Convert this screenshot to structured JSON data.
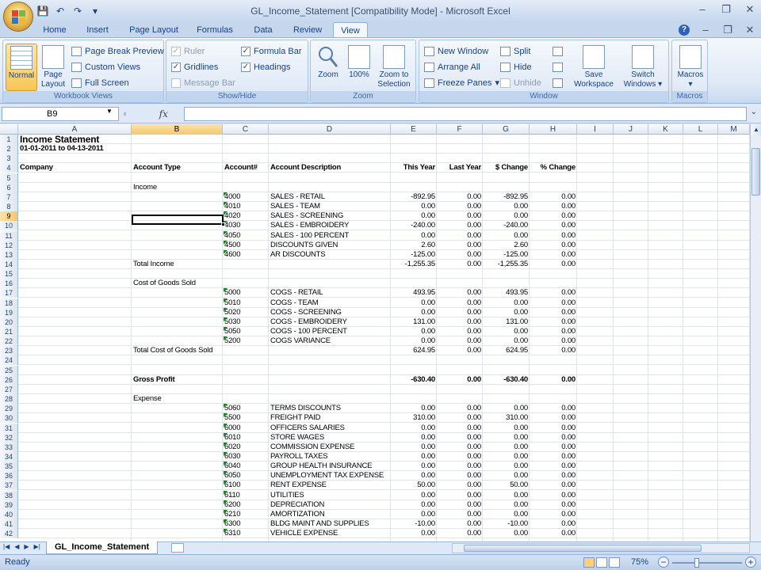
{
  "window": {
    "title": "GL_Income_Statement [Compatibility Mode] - Microsoft Excel",
    "minimize": "–",
    "restore": "❐",
    "close": "✕"
  },
  "qat": {
    "save": "💾",
    "undo": "↶",
    "redo": "↷",
    "customize": "▾"
  },
  "tabs": [
    "Home",
    "Insert",
    "Page Layout",
    "Formulas",
    "Data",
    "Review",
    "View"
  ],
  "active_tab": "View",
  "ribbon": {
    "workbook_views": {
      "label": "Workbook Views",
      "normal": "Normal",
      "page_layout_1": "Page",
      "page_layout_2": "Layout",
      "page_break_preview": "Page Break Preview",
      "custom_views": "Custom Views",
      "full_screen": "Full Screen"
    },
    "show_hide": {
      "label": "Show/Hide",
      "ruler": "Ruler",
      "gridlines": "Gridlines",
      "message_bar": "Message Bar",
      "formula_bar": "Formula Bar",
      "headings": "Headings"
    },
    "zoom": {
      "label": "Zoom",
      "zoom": "Zoom",
      "hundred": "100%",
      "zoom_selection_1": "Zoom to",
      "zoom_selection_2": "Selection"
    },
    "window": {
      "label": "Window",
      "new_window": "New Window",
      "arrange_all": "Arrange All",
      "freeze_panes": "Freeze Panes",
      "split": "Split",
      "hide": "Hide",
      "unhide": "Unhide",
      "save_workspace_1": "Save",
      "save_workspace_2": "Workspace",
      "switch_windows_1": "Switch",
      "switch_windows_2": "Windows"
    },
    "macros": {
      "label": "Macros",
      "macros": "Macros"
    }
  },
  "formula_bar": {
    "name_box": "B9",
    "fx": "fx",
    "formula": ""
  },
  "columns": [
    "A",
    "B",
    "C",
    "D",
    "E",
    "F",
    "G",
    "H",
    "I",
    "J",
    "K",
    "L",
    "M"
  ],
  "selected_column": "B",
  "selected_row": 9,
  "sheet": {
    "title": "Income Statement",
    "date_range": "01-01-2011 to 04-13-2011",
    "headers": {
      "company": "Company",
      "account_type": "Account Type",
      "account_num": "Account#",
      "account_desc": "Account Description",
      "this_year": "This Year",
      "last_year": "Last Year",
      "dollar_change": "$ Change",
      "pct_change": "% Change"
    },
    "rows": [
      {
        "r": 6,
        "b": "Income"
      },
      {
        "r": 7,
        "c": "4000",
        "d": "SALES - RETAIL",
        "e": "-892.95",
        "f": "0.00",
        "g": "-892.95",
        "h": "0.00"
      },
      {
        "r": 8,
        "c": "4010",
        "d": "SALES - TEAM",
        "e": "0.00",
        "f": "0.00",
        "g": "0.00",
        "h": "0.00"
      },
      {
        "r": 9,
        "c": "4020",
        "d": "SALES - SCREENING",
        "e": "0.00",
        "f": "0.00",
        "g": "0.00",
        "h": "0.00"
      },
      {
        "r": 10,
        "c": "4030",
        "d": "SALES - EMBROIDERY",
        "e": "-240.00",
        "f": "0.00",
        "g": "-240.00",
        "h": "0.00"
      },
      {
        "r": 11,
        "c": "4050",
        "d": "SALES - 100 PERCENT",
        "e": "0.00",
        "f": "0.00",
        "g": "0.00",
        "h": "0.00"
      },
      {
        "r": 12,
        "c": "4500",
        "d": "DISCOUNTS GIVEN",
        "e": "2.60",
        "f": "0.00",
        "g": "2.60",
        "h": "0.00"
      },
      {
        "r": 13,
        "c": "4600",
        "d": "AR DISCOUNTS",
        "e": "-125.00",
        "f": "0.00",
        "g": "-125.00",
        "h": "0.00"
      },
      {
        "r": 14,
        "b": "Total Income",
        "e": "-1,255.35",
        "f": "0.00",
        "g": "-1,255.35",
        "h": "0.00"
      },
      {
        "r": 16,
        "b": "Cost of Goods Sold"
      },
      {
        "r": 17,
        "c": "5000",
        "d": "COGS - RETAIL",
        "e": "493.95",
        "f": "0.00",
        "g": "493.95",
        "h": "0.00"
      },
      {
        "r": 18,
        "c": "5010",
        "d": "COGS - TEAM",
        "e": "0.00",
        "f": "0.00",
        "g": "0.00",
        "h": "0.00"
      },
      {
        "r": 19,
        "c": "5020",
        "d": "COGS - SCREENING",
        "e": "0.00",
        "f": "0.00",
        "g": "0.00",
        "h": "0.00"
      },
      {
        "r": 20,
        "c": "5030",
        "d": "COGS - EMBROIDERY",
        "e": "131.00",
        "f": "0.00",
        "g": "131.00",
        "h": "0.00"
      },
      {
        "r": 21,
        "c": "5050",
        "d": "COGS - 100 PERCENT",
        "e": "0.00",
        "f": "0.00",
        "g": "0.00",
        "h": "0.00"
      },
      {
        "r": 22,
        "c": "5200",
        "d": "COGS VARIANCE",
        "e": "0.00",
        "f": "0.00",
        "g": "0.00",
        "h": "0.00"
      },
      {
        "r": 23,
        "b": "Total Cost of Goods Sold",
        "e": "624.95",
        "f": "0.00",
        "g": "624.95",
        "h": "0.00"
      },
      {
        "r": 26,
        "b": "Gross Profit",
        "e": "-630.40",
        "f": "0.00",
        "g": "-630.40",
        "h": "0.00",
        "bold": true
      },
      {
        "r": 28,
        "b": "Expense"
      },
      {
        "r": 29,
        "c": "5060",
        "d": "TERMS DISCOUNTS",
        "e": "0.00",
        "f": "0.00",
        "g": "0.00",
        "h": "0.00"
      },
      {
        "r": 30,
        "c": "5500",
        "d": "FREIGHT PAID",
        "e": "310.00",
        "f": "0.00",
        "g": "310.00",
        "h": "0.00"
      },
      {
        "r": 31,
        "c": "6000",
        "d": "OFFICERS SALARIES",
        "e": "0.00",
        "f": "0.00",
        "g": "0.00",
        "h": "0.00"
      },
      {
        "r": 32,
        "c": "6010",
        "d": "STORE WAGES",
        "e": "0.00",
        "f": "0.00",
        "g": "0.00",
        "h": "0.00"
      },
      {
        "r": 33,
        "c": "6020",
        "d": "COMMISSION EXPENSE",
        "e": "0.00",
        "f": "0.00",
        "g": "0.00",
        "h": "0.00"
      },
      {
        "r": 34,
        "c": "6030",
        "d": "PAYROLL TAXES",
        "e": "0.00",
        "f": "0.00",
        "g": "0.00",
        "h": "0.00"
      },
      {
        "r": 35,
        "c": "6040",
        "d": "GROUP HEALTH INSURANCE",
        "e": "0.00",
        "f": "0.00",
        "g": "0.00",
        "h": "0.00"
      },
      {
        "r": 36,
        "c": "6050",
        "d": "UNEMPLOYMENT TAX EXPENSE",
        "e": "0.00",
        "f": "0.00",
        "g": "0.00",
        "h": "0.00"
      },
      {
        "r": 37,
        "c": "6100",
        "d": "RENT EXPENSE",
        "e": "50.00",
        "f": "0.00",
        "g": "50.00",
        "h": "0.00"
      },
      {
        "r": 38,
        "c": "6110",
        "d": "UTILITIES",
        "e": "0.00",
        "f": "0.00",
        "g": "0.00",
        "h": "0.00"
      },
      {
        "r": 39,
        "c": "6200",
        "d": "DEPRECIATION",
        "e": "0.00",
        "f": "0.00",
        "g": "0.00",
        "h": "0.00"
      },
      {
        "r": 40,
        "c": "6210",
        "d": "AMORTIZATION",
        "e": "0.00",
        "f": "0.00",
        "g": "0.00",
        "h": "0.00"
      },
      {
        "r": 41,
        "c": "6300",
        "d": "BLDG MAINT AND SUPPLIES",
        "e": "-10.00",
        "f": "0.00",
        "g": "-10.00",
        "h": "0.00"
      },
      {
        "r": 42,
        "c": "6310",
        "d": "VEHICLE EXPENSE",
        "e": "0.00",
        "f": "0.00",
        "g": "0.00",
        "h": "0.00"
      }
    ]
  },
  "sheet_tab": "GL_Income_Statement",
  "status": {
    "text": "Ready",
    "zoom": "75%"
  }
}
